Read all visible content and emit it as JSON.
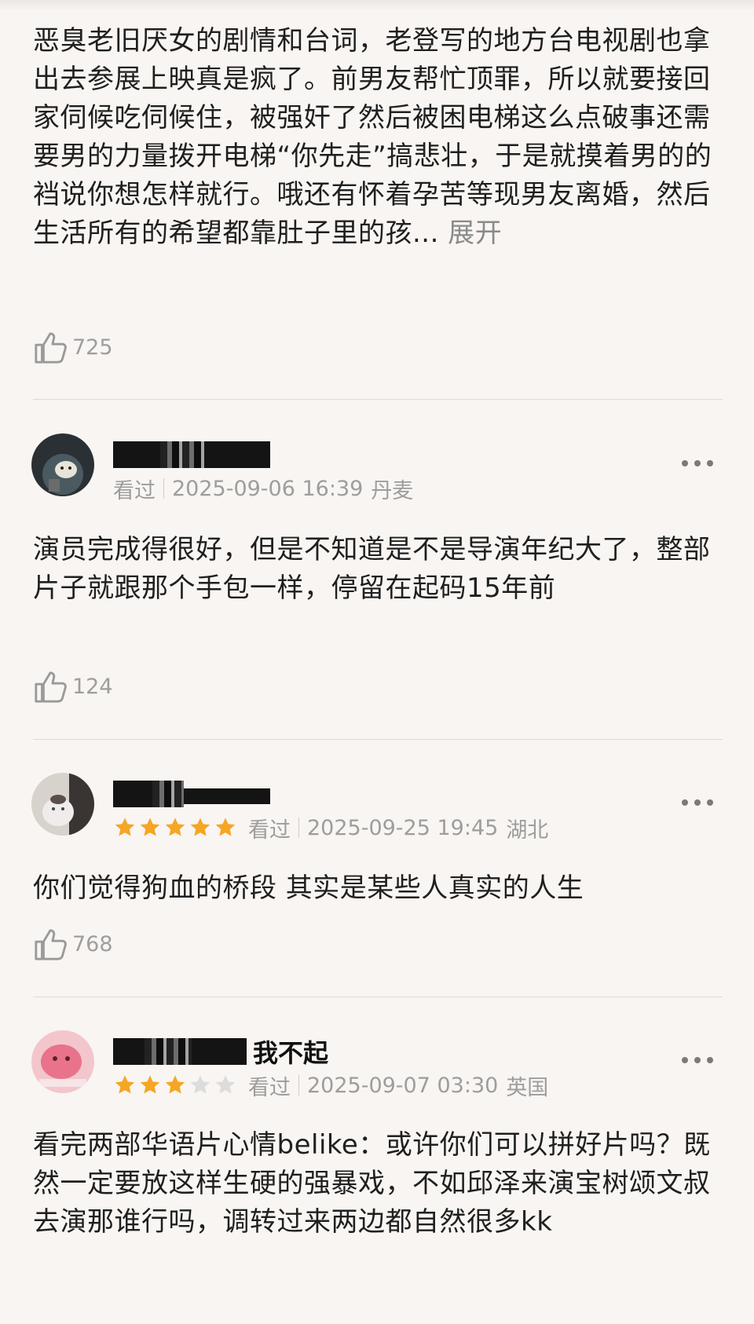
{
  "comments": [
    {
      "text": "恶臭老旧厌女的剧情和台词，老登写的地方台电视剧也拿出去参展上映真是疯了。前男友帮忙顶罪，所以就要接回家伺候吃伺候住，被强奸了然后被困电梯这么点破事还需要男的力量拨开电梯“你先走”搞悲壮，于是就摸着男的的裆说你想怎样就行。哦还有怀着孕苦等现男友离婚，然后生活所有的希望都靠肚子里的孩... ",
      "expand_label": "展开",
      "likes": "725"
    },
    {
      "username": "",
      "status": "看过",
      "datetime": "2025-09-06 16:39",
      "location": "丹麦",
      "text": "演员完成得很好，但是不知道是不是导演年纪大了，整部片子就跟那个手包一样，停留在起码15年前",
      "likes": "124"
    },
    {
      "username": "",
      "rating": 5,
      "status": "看过",
      "datetime": "2025-09-25 19:45",
      "location": "湖北",
      "text": "你们觉得狗血的桥段 其实是某些人真实的人生",
      "likes": "768"
    },
    {
      "username": "我不起",
      "rating": 3,
      "status": "看过",
      "datetime": "2025-09-07 03:30",
      "location": "英国",
      "text": "看完两部华语片心情belike：或许你们可以拼好片吗？既然一定要放这样生硬的强暴戏，不如邱泽来演宝树颂文叔去演那谁行吗，调转过来两边都自然很多kk"
    }
  ],
  "colors": {
    "background": "#f8f5f2",
    "star_filled": "#f5a623",
    "star_empty": "#dcdcdc",
    "meta_text": "#9d9d9d"
  },
  "icons": {
    "like": "thumbs-up-icon",
    "more": "more-dots-icon",
    "star": "star-icon"
  }
}
